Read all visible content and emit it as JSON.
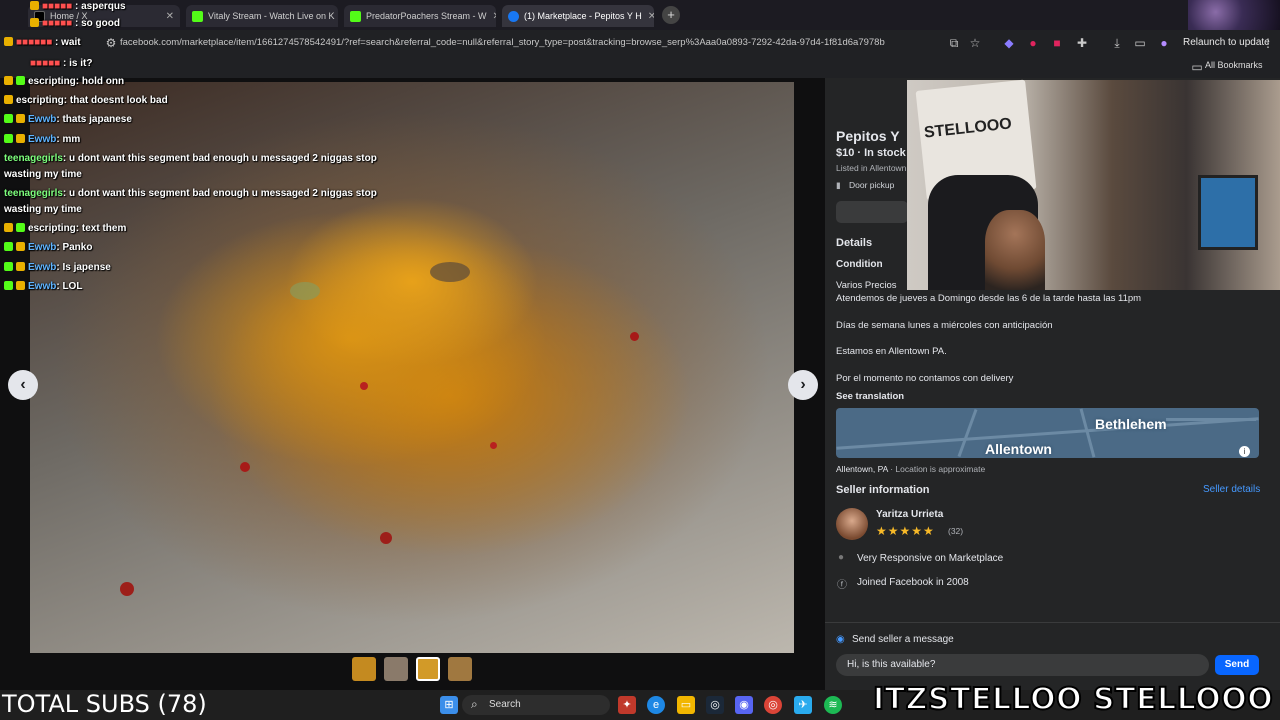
{
  "browser": {
    "tabs": [
      {
        "label": "Home / X",
        "favicon_color": "#000000"
      },
      {
        "label": "Vitaly Stream - Watch Live on K",
        "favicon_color": "#53fc18"
      },
      {
        "label": "PredatorPoachers Stream - W",
        "favicon_color": "#53fc18"
      },
      {
        "label": "(1) Marketplace - Pepitos Y H",
        "favicon_color": "#1877f2"
      }
    ],
    "new_tab": "+",
    "url": "facebook.com/marketplace/item/1661274578542491/?ref=search&referral_code=null&referral_story_type=post&tracking=browse_serp%3Aaa0a0893-7292-42da-97d4-1f81d6a7978b",
    "relaunch_label": "Relaunch to update",
    "all_bookmarks": "All Bookmarks"
  },
  "chat": [
    {
      "user": "escripting",
      "text": ": hold onn",
      "color": "white"
    },
    {
      "user": "escripting",
      "text": ": that doesnt look bad",
      "color": "white"
    },
    {
      "user": "Ewwb",
      "text": ": thats japanese",
      "color": "blue"
    },
    {
      "user": "Ewwb",
      "text": ": mm",
      "color": "blue"
    },
    {
      "user": "teenagegirls",
      "text": ": u dont want this segment bad enough u messaged 2 niggas stop",
      "color": "green"
    },
    {
      "user": "",
      "text": "wasting my time",
      "color": "white"
    },
    {
      "user": "teenagegirls",
      "text": ": u dont want this segment bad enough u messaged 2 niggas stop",
      "color": "green"
    },
    {
      "user": "",
      "text": "wasting my time",
      "color": "white"
    },
    {
      "user": "escripting",
      "text": ": text them",
      "color": "white"
    },
    {
      "user": "Ewwb",
      "text": ": Panko",
      "color": "blue"
    },
    {
      "user": "Ewwb",
      "text": ": Is japense",
      "color": "blue"
    },
    {
      "user": "Ewwb",
      "text": ": LOL",
      "color": "blue"
    }
  ],
  "chat_top": {
    "line1": "asperqus",
    "line2": "so good",
    "line3": "wait",
    "line4": "is it?"
  },
  "listing": {
    "title": "Pepitos Y",
    "price_stock": "$10 · In stock",
    "listed": "Listed in Allentown",
    "pickup": "Door pickup",
    "details_heading": "Details",
    "condition_label": "Condition",
    "description": [
      "Varios Precios",
      "Atendemos de jueves a Domingo desde las 6 de la tarde hasta las 11pm",
      "Días de semana lunes a miércoles con anticipación",
      "Estamos en Allentown PA.",
      "Por el momento no contamos con delivery"
    ],
    "see_translation": "See translation",
    "map": {
      "city1": "Bethlehem",
      "city2": "Allentown"
    },
    "location": "Allentown, PA",
    "location_note": "· Location is approximate",
    "seller_heading": "Seller information",
    "seller_details": "Seller details",
    "seller_name": "Yaritza Urrieta",
    "rating": 4.5,
    "rating_count": "(32)",
    "stars_text": "★★★★★",
    "responsive": "Very Responsive on Marketplace",
    "joined": "Joined Facebook in 2008",
    "send_heading": "Send seller a message",
    "message": "Hi, is this available?",
    "send": "Send"
  },
  "overlay": {
    "subs": "TOTAL SUBS (78)",
    "brand": "ITZSTELLOO  STELLOOO",
    "sign": "STELLOOO"
  },
  "taskbar": {
    "search": "Search"
  },
  "colors": {
    "fb_blue": "#0866ff",
    "panel": "#242526",
    "kick_green": "#53fc18"
  }
}
